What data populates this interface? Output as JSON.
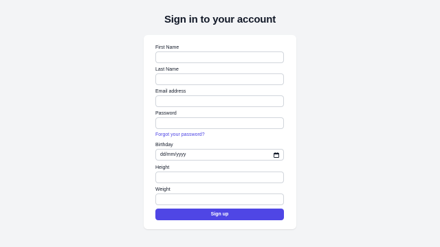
{
  "page": {
    "title": "Sign in to your account"
  },
  "form": {
    "first_name": {
      "label": "First Name",
      "value": ""
    },
    "last_name": {
      "label": "Last Name",
      "value": ""
    },
    "email": {
      "label": "Email address",
      "value": ""
    },
    "password": {
      "label": "Password",
      "value": ""
    },
    "forgot_link": "Forgot your password?",
    "birthday": {
      "label": "Birthday",
      "placeholder": "dd/mm/yyyy"
    },
    "height": {
      "label": "Height",
      "value": ""
    },
    "weight": {
      "label": "Weight",
      "value": ""
    },
    "submit_label": "Sign up"
  },
  "colors": {
    "accent": "#4f46e5",
    "background": "#f3f4f6"
  },
  "icons": {
    "birthday_picker": "calendar-icon"
  }
}
